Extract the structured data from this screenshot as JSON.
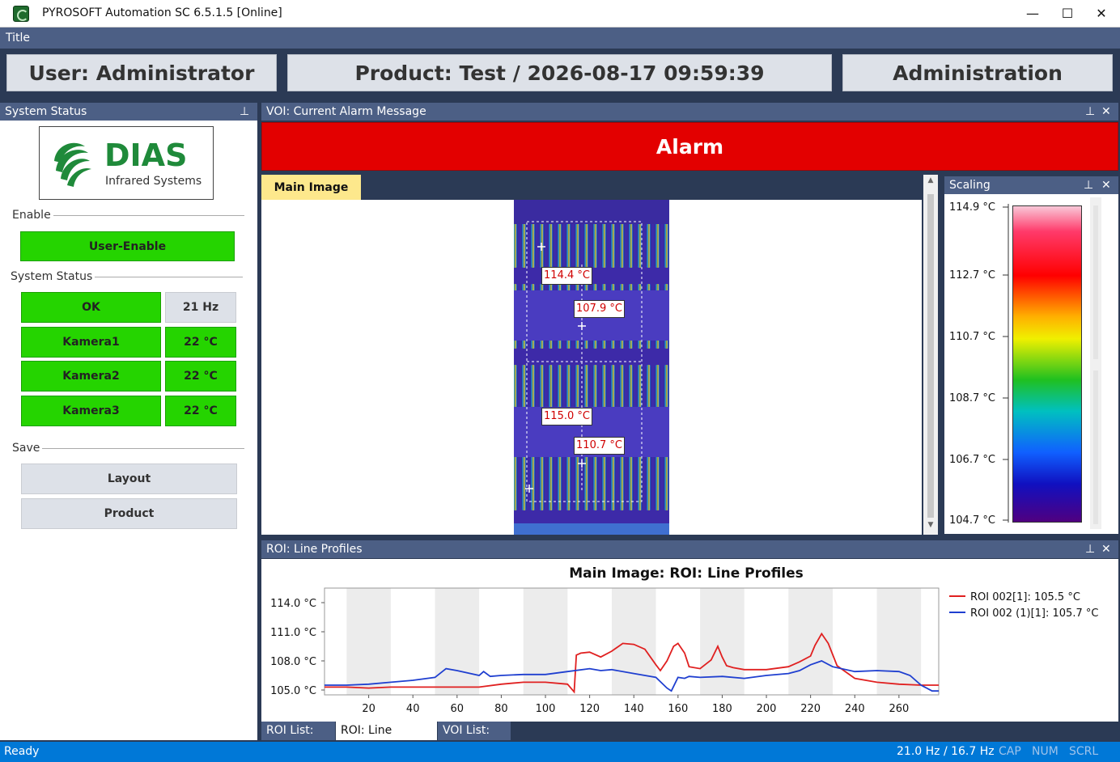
{
  "window": {
    "title": "PYROSOFT Automation SC 6.5.1.5  [Online]",
    "minimize": "—",
    "maximize": "☐",
    "close": "✕"
  },
  "menu": {
    "title": "Title"
  },
  "header": {
    "user": "User: Administrator",
    "product": "Product: Test / 2026-08-17 09:59:39",
    "admin": "Administration"
  },
  "left": {
    "header": "System Status",
    "pin": "📌",
    "logo_text": "DIAS",
    "logo_sub": "Infrared Systems",
    "enable_label": "Enable",
    "user_enable": "User-Enable",
    "status_label": "System Status",
    "status_rows": [
      {
        "name": "OK",
        "value": "21 Hz"
      },
      {
        "name": "Kamera1",
        "value": "22 °C"
      },
      {
        "name": "Kamera2",
        "value": "22 °C"
      },
      {
        "name": "Kamera3",
        "value": "22 °C"
      }
    ],
    "save_label": "Save",
    "layout_btn": "Layout",
    "product_btn": "Product"
  },
  "voi": {
    "header": "VOI: Current Alarm Message",
    "alarm": "Alarm"
  },
  "image": {
    "tab": "Main Image",
    "labels": [
      "114.4 °C",
      "107.9 °C",
      "115.0 °C",
      "110.7 °C"
    ]
  },
  "scaling": {
    "header": "Scaling",
    "ticks": [
      "114.9 °C",
      "112.7 °C",
      "110.7 °C",
      "108.7 °C",
      "106.7 °C",
      "104.7 °C"
    ]
  },
  "profile": {
    "header": "ROI: Line Profiles",
    "title": "Main Image: ROI: Line Profiles"
  },
  "chart_data": {
    "type": "line",
    "title": "Main Image: ROI: Line Profiles",
    "xlabel": "",
    "ylabel": "",
    "xlim": [
      0,
      278
    ],
    "ylim": [
      104.5,
      115.5
    ],
    "x_ticks": [
      "20",
      "40",
      "60",
      "80",
      "100",
      "120",
      "140",
      "160",
      "180",
      "200",
      "220",
      "240",
      "260"
    ],
    "y_ticks": [
      "114.0 °C",
      "111.0 °C",
      "108.0 °C",
      "105.0 °C"
    ],
    "legend_position": "right",
    "series": [
      {
        "name": "ROI 002[1]: 105.5 °C",
        "color": "#e02020",
        "x": [
          0,
          10,
          20,
          30,
          40,
          50,
          60,
          70,
          80,
          90,
          100,
          110,
          113,
          114,
          116,
          120,
          125,
          130,
          135,
          140,
          145,
          150,
          152,
          155,
          158,
          160,
          163,
          165,
          170,
          175,
          178,
          180,
          182,
          185,
          190,
          200,
          210,
          215,
          220,
          222,
          225,
          228,
          232,
          240,
          250,
          260,
          270,
          278
        ],
        "y": [
          105.3,
          105.3,
          105.2,
          105.3,
          105.3,
          105.3,
          105.3,
          105.3,
          105.6,
          105.8,
          105.8,
          105.6,
          104.8,
          108.6,
          108.8,
          108.9,
          108.4,
          109.0,
          109.8,
          109.7,
          109.2,
          107.6,
          107.0,
          108.0,
          109.5,
          109.8,
          108.8,
          107.4,
          107.2,
          108.1,
          109.5,
          108.4,
          107.5,
          107.3,
          107.1,
          107.1,
          107.4,
          107.9,
          108.5,
          109.6,
          110.8,
          109.8,
          107.5,
          106.2,
          105.8,
          105.6,
          105.5,
          105.5
        ]
      },
      {
        "name": "ROI 002 (1)[1]: 105.7 °C",
        "color": "#1f3fd0",
        "x": [
          0,
          10,
          20,
          30,
          40,
          50,
          55,
          60,
          70,
          72,
          75,
          80,
          90,
          100,
          110,
          120,
          125,
          130,
          140,
          145,
          150,
          155,
          157,
          160,
          163,
          165,
          170,
          180,
          190,
          200,
          210,
          215,
          220,
          225,
          230,
          240,
          250,
          260,
          265,
          270,
          275,
          278
        ],
        "y": [
          105.5,
          105.5,
          105.6,
          105.8,
          106.0,
          106.3,
          107.2,
          107.0,
          106.5,
          106.9,
          106.4,
          106.5,
          106.6,
          106.6,
          106.9,
          107.2,
          107.0,
          107.1,
          106.7,
          106.5,
          106.3,
          105.2,
          104.9,
          106.3,
          106.2,
          106.4,
          106.3,
          106.4,
          106.2,
          106.5,
          106.7,
          107.0,
          107.6,
          108.0,
          107.4,
          106.9,
          107.0,
          106.9,
          106.5,
          105.5,
          104.9,
          104.9
        ]
      }
    ]
  },
  "bottom_tabs": [
    "ROI List: All",
    "ROI: Line Profiles",
    "VOI List: All"
  ],
  "status": {
    "ready": "Ready",
    "rate": "21.0 Hz / 16.7 Hz",
    "cap": "CAP",
    "num": "NUM",
    "scrl": "SCRL"
  }
}
